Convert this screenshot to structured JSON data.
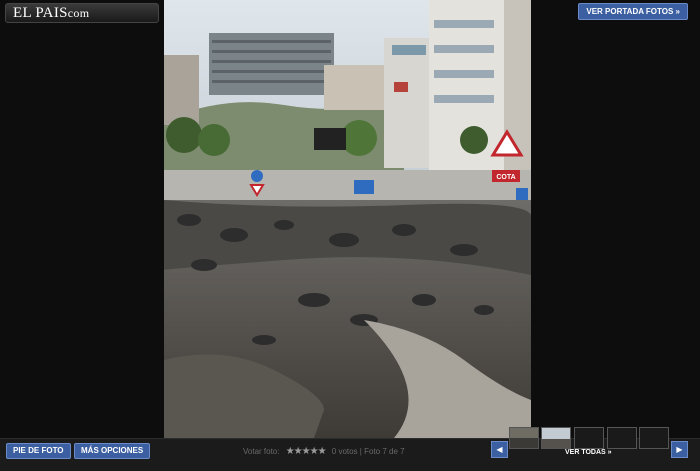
{
  "header": {
    "logo_main": "EL PAIS",
    "logo_suffix": "com",
    "portada_button": "VER PORTADA FOTOS »"
  },
  "footer": {
    "pie_button": "PIE DE FOTO",
    "opciones_button": "MÁS OPCIONES",
    "votar_label": "Votar foto:",
    "stars": "★★★★★",
    "votes": "0 votos",
    "foto_counter": "Foto 7 de 7",
    "prev": "◀",
    "next": "▶",
    "ver_todas": "VER TODAS »"
  },
  "photo": {
    "sign_text": "COTA"
  },
  "colors": {
    "accent": "#3b5fa0",
    "background": "#0d0d0d"
  }
}
